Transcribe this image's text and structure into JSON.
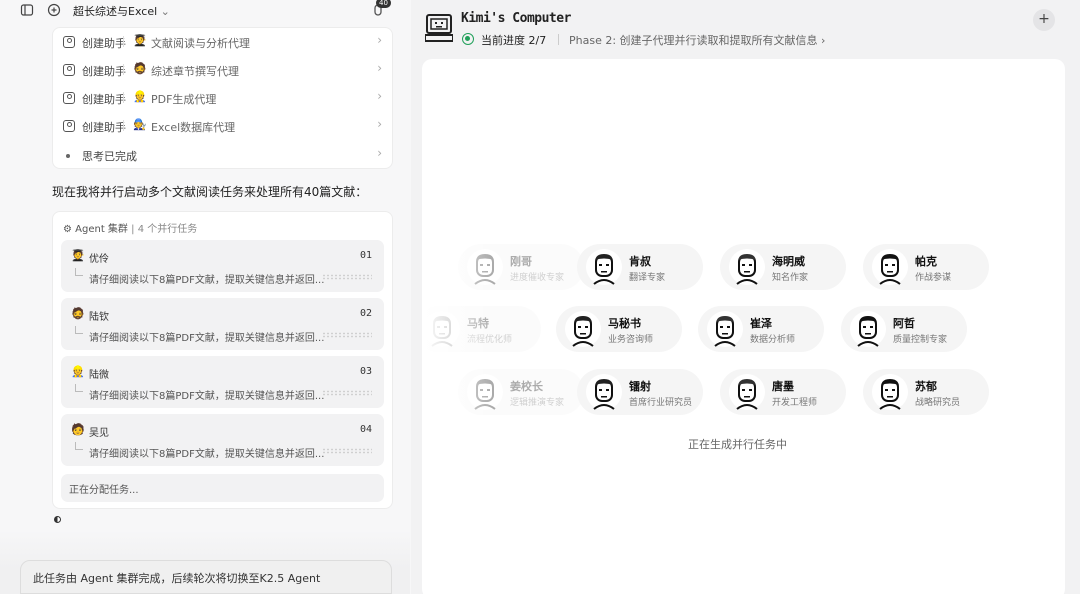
{
  "topbar": {
    "title": "超长综述与Excel",
    "badge": "40"
  },
  "steps": [
    {
      "label": "创建助手",
      "avatar": "🧑‍🎓",
      "agent": "文献阅读与分析代理"
    },
    {
      "label": "创建助手",
      "avatar": "🧔",
      "agent": "综述章节撰写代理"
    },
    {
      "label": "创建助手",
      "avatar": "👷",
      "agent": "PDF生成代理"
    },
    {
      "label": "创建助手",
      "avatar": "🧑‍🔧",
      "agent": "Excel数据库代理"
    }
  ],
  "thinking": "思考已完成",
  "message": "现在我将并行启动多个文献阅读任务来处理所有40篇文献：",
  "agent_group": {
    "title": "Agent 集群",
    "subtitle": "4 个并行任务",
    "tasks": [
      {
        "avatar": "🧑‍🎓",
        "name": "优伶",
        "no": "01",
        "desc": "请仔细阅读以下8篇PDF文献，提取关键信息并返回..."
      },
      {
        "avatar": "🧔",
        "name": "陆钦",
        "no": "02",
        "desc": "请仔细阅读以下8篇PDF文献，提取关键信息并返回..."
      },
      {
        "avatar": "👷",
        "name": "陆微",
        "no": "03",
        "desc": "请仔细阅读以下8篇PDF文献，提取关键信息并返回..."
      },
      {
        "avatar": "🧑",
        "name": "吴见",
        "no": "04",
        "desc": "请仔细阅读以下8篇PDF文献，提取关键信息并返回..."
      }
    ],
    "assigning": "正在分配任务..."
  },
  "footer": "此任务由 Agent 集群完成，后续轮次将切换至K2.5 Agent",
  "computer": {
    "title": "Kimi's Computer",
    "progress": "当前进度 2/7",
    "phase": "Phase 2: 创建子代理并行读取和提取所有文献信息 ›",
    "status_color": "#21a05a",
    "generating": "正在生成并行任务中"
  },
  "agents_row1": [
    {
      "name": "刚哥",
      "role": "进度催收专家"
    },
    {
      "name": "肯叔",
      "role": "翻译专家"
    },
    {
      "name": "海明威",
      "role": "知名作家"
    },
    {
      "name": "帕克",
      "role": "作战参谋"
    }
  ],
  "agents_row2": [
    {
      "name": "马特",
      "role": "流程优化师"
    },
    {
      "name": "马秘书",
      "role": "业务咨询师"
    },
    {
      "name": "崔泽",
      "role": "数据分析师"
    },
    {
      "name": "阿哲",
      "role": "质量控制专家"
    }
  ],
  "agents_row3": [
    {
      "name": "姜校长",
      "role": "逻辑推演专家"
    },
    {
      "name": "镭射",
      "role": "首席行业研究员"
    },
    {
      "name": "唐墨",
      "role": "开发工程师"
    },
    {
      "name": "苏郁",
      "role": "战略研究员"
    }
  ]
}
